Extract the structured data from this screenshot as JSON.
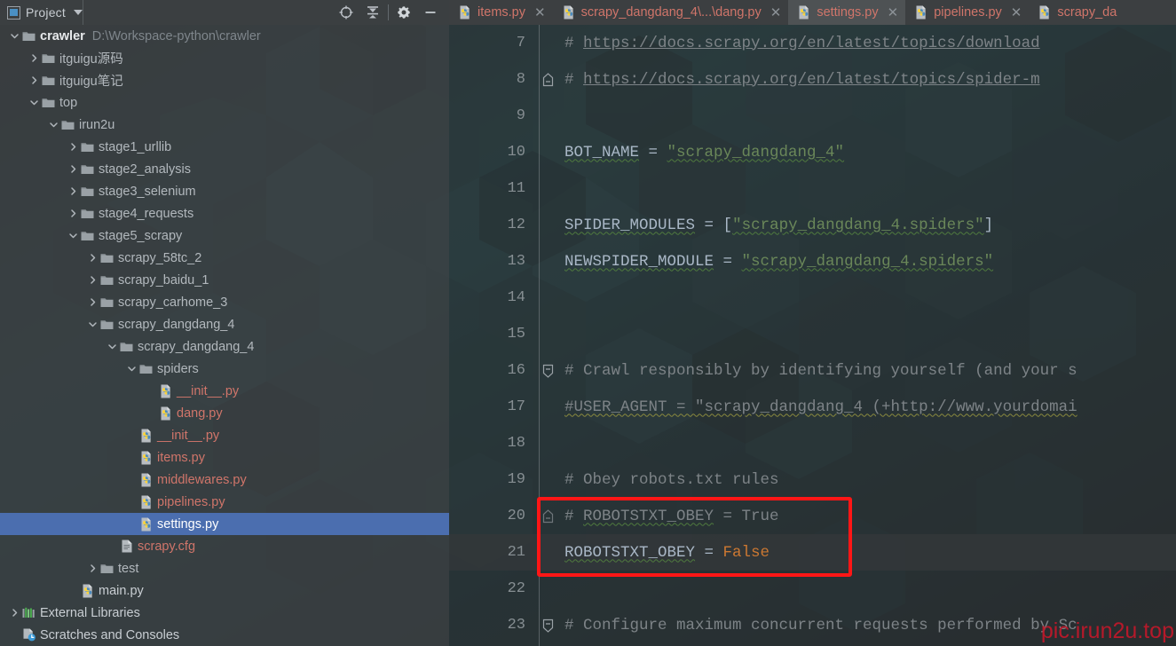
{
  "window": {
    "tool_window_title": "Project"
  },
  "project_toolbar": {
    "icons": [
      {
        "name": "locate-target-icon",
        "title": "Select Opened File"
      },
      {
        "name": "collapse-all-icon",
        "title": "Collapse All"
      },
      {
        "name": "gear-icon",
        "title": "Settings"
      },
      {
        "name": "minimize-icon",
        "title": "Hide"
      }
    ]
  },
  "project_tree": [
    {
      "label": "crawler",
      "path": "D:\\Workspace-python\\crawler",
      "depth": 0,
      "kind": "root",
      "state": "expanded",
      "icon": "folder-icon"
    },
    {
      "label": "itguigu源码",
      "depth": 1,
      "kind": "folder",
      "state": "collapsed",
      "icon": "folder-icon"
    },
    {
      "label": "itguigu笔记",
      "depth": 1,
      "kind": "folder",
      "state": "collapsed",
      "icon": "folder-icon"
    },
    {
      "label": "top",
      "depth": 1,
      "kind": "folder",
      "state": "expanded",
      "icon": "folder-icon"
    },
    {
      "label": "irun2u",
      "depth": 2,
      "kind": "folder",
      "state": "expanded",
      "icon": "folder-icon"
    },
    {
      "label": "stage1_urllib",
      "depth": 3,
      "kind": "folder",
      "state": "collapsed",
      "icon": "folder-icon"
    },
    {
      "label": "stage2_analysis",
      "depth": 3,
      "kind": "folder",
      "state": "collapsed",
      "icon": "folder-icon"
    },
    {
      "label": "stage3_selenium",
      "depth": 3,
      "kind": "folder",
      "state": "collapsed",
      "icon": "folder-icon"
    },
    {
      "label": "stage4_requests",
      "depth": 3,
      "kind": "folder",
      "state": "collapsed",
      "icon": "folder-icon"
    },
    {
      "label": "stage5_scrapy",
      "depth": 3,
      "kind": "folder",
      "state": "expanded",
      "icon": "folder-icon"
    },
    {
      "label": "scrapy_58tc_2",
      "depth": 4,
      "kind": "folder",
      "state": "collapsed",
      "icon": "folder-icon"
    },
    {
      "label": "scrapy_baidu_1",
      "depth": 4,
      "kind": "folder",
      "state": "collapsed",
      "icon": "folder-icon"
    },
    {
      "label": "scrapy_carhome_3",
      "depth": 4,
      "kind": "folder",
      "state": "collapsed",
      "icon": "folder-icon"
    },
    {
      "label": "scrapy_dangdang_4",
      "depth": 4,
      "kind": "folder",
      "state": "expanded",
      "icon": "folder-icon"
    },
    {
      "label": "scrapy_dangdang_4",
      "depth": 5,
      "kind": "folder",
      "state": "expanded",
      "icon": "folder-icon"
    },
    {
      "label": "spiders",
      "depth": 6,
      "kind": "folder",
      "state": "expanded",
      "icon": "folder-icon"
    },
    {
      "label": "__init__.py",
      "depth": 7,
      "kind": "python",
      "state": "leaf",
      "icon": "python-file-icon"
    },
    {
      "label": "dang.py",
      "depth": 7,
      "kind": "python",
      "state": "leaf",
      "icon": "python-file-icon"
    },
    {
      "label": "__init__.py",
      "depth": 6,
      "kind": "python",
      "state": "leaf",
      "icon": "python-file-icon"
    },
    {
      "label": "items.py",
      "depth": 6,
      "kind": "python",
      "state": "leaf",
      "icon": "python-file-icon"
    },
    {
      "label": "middlewares.py",
      "depth": 6,
      "kind": "python",
      "state": "leaf",
      "icon": "python-file-icon"
    },
    {
      "label": "pipelines.py",
      "depth": 6,
      "kind": "python",
      "state": "leaf",
      "icon": "python-file-icon"
    },
    {
      "label": "settings.py",
      "depth": 6,
      "kind": "python",
      "state": "leaf",
      "icon": "python-file-icon",
      "selected": true
    },
    {
      "label": "scrapy.cfg",
      "depth": 5,
      "kind": "cfg",
      "state": "leaf",
      "icon": "text-file-icon"
    },
    {
      "label": "test",
      "depth": 4,
      "kind": "folder",
      "state": "collapsed",
      "icon": "folder-icon"
    },
    {
      "label": "main.py",
      "depth": 3,
      "kind": "python-white",
      "state": "leaf",
      "icon": "python-file-icon"
    },
    {
      "label": "External Libraries",
      "depth": 0,
      "kind": "libs",
      "state": "collapsed",
      "icon": "libraries-icon"
    },
    {
      "label": "Scratches and Consoles",
      "depth": 0,
      "kind": "scratches",
      "state": "leaf",
      "icon": "scratches-icon"
    }
  ],
  "editor_tabs": [
    {
      "label": "items.py",
      "icon": "python-file-icon",
      "active": false,
      "closable": true
    },
    {
      "label": "scrapy_dangdang_4\\...\\dang.py",
      "icon": "python-file-icon",
      "active": false,
      "closable": true
    },
    {
      "label": "settings.py",
      "icon": "python-file-icon",
      "active": true,
      "closable": true
    },
    {
      "label": "pipelines.py",
      "icon": "python-file-icon",
      "active": false,
      "closable": true
    },
    {
      "label": "scrapy_da",
      "icon": "python-file-icon",
      "active": false,
      "closable": false
    }
  ],
  "code_lines": [
    {
      "num": "7",
      "fold": "none",
      "current": false,
      "tokens": [
        {
          "t": "#",
          "c": "c-cmt"
        },
        {
          "t": "      ",
          "c": "c-cmt"
        },
        {
          "t": "https://docs.scrapy.org/en/latest/topics/download",
          "c": "c-link"
        }
      ]
    },
    {
      "num": "8",
      "fold": "end",
      "current": false,
      "tokens": [
        {
          "t": "#",
          "c": "c-cmt"
        },
        {
          "t": "      ",
          "c": "c-cmt"
        },
        {
          "t": "https://docs.scrapy.org/en/latest/topics/spider-m",
          "c": "c-link"
        }
      ]
    },
    {
      "num": "9",
      "fold": "none",
      "current": false,
      "tokens": []
    },
    {
      "num": "10",
      "fold": "none",
      "current": false,
      "tokens": [
        {
          "t": "BOT_NAME",
          "c": "c-var sq-green"
        },
        {
          "t": " = ",
          "c": "c-op"
        },
        {
          "t": "\"scrapy_dangdang_4\"",
          "c": "c-str sq-green"
        }
      ]
    },
    {
      "num": "11",
      "fold": "none",
      "current": false,
      "tokens": []
    },
    {
      "num": "12",
      "fold": "none",
      "current": false,
      "tokens": [
        {
          "t": "SPIDER_MODULES",
          "c": "c-var sq-green"
        },
        {
          "t": " = ",
          "c": "c-op"
        },
        {
          "t": "[",
          "c": "c-brk"
        },
        {
          "t": "\"scrapy_dangdang_4.spiders\"",
          "c": "c-str sq-green"
        },
        {
          "t": "]",
          "c": "c-brk"
        }
      ]
    },
    {
      "num": "13",
      "fold": "none",
      "current": false,
      "tokens": [
        {
          "t": "NEWSPIDER_MODULE",
          "c": "c-var sq-green"
        },
        {
          "t": " = ",
          "c": "c-op"
        },
        {
          "t": "\"scrapy_dangdang_4.spiders\"",
          "c": "c-str sq-green"
        }
      ]
    },
    {
      "num": "14",
      "fold": "none",
      "current": false,
      "tokens": []
    },
    {
      "num": "15",
      "fold": "none",
      "current": false,
      "tokens": []
    },
    {
      "num": "16",
      "fold": "start",
      "current": false,
      "tokens": [
        {
          "t": "# Crawl responsibly by identifying yourself (and your s",
          "c": "c-cmt"
        }
      ]
    },
    {
      "num": "17",
      "fold": "none",
      "current": false,
      "tokens": [
        {
          "t": "#USER_AGENT = \"scrapy_dangdang_4 (+http://www.yourdomai",
          "c": "c-cmt sq-olive"
        }
      ]
    },
    {
      "num": "18",
      "fold": "none",
      "current": false,
      "tokens": []
    },
    {
      "num": "19",
      "fold": "none",
      "current": false,
      "tokens": [
        {
          "t": "# Obey robots.txt rules",
          "c": "c-cmt"
        }
      ]
    },
    {
      "num": "20",
      "fold": "boxed",
      "current": false,
      "tokens": [
        {
          "t": "# ",
          "c": "c-cmt"
        },
        {
          "t": "ROBOTSTXT_OBEY",
          "c": "c-cmt sq-green"
        },
        {
          "t": " = True",
          "c": "c-cmt"
        }
      ]
    },
    {
      "num": "21",
      "fold": "none",
      "current": true,
      "tokens": [
        {
          "t": "ROBOTSTXT_OBEY",
          "c": "c-var sq-green"
        },
        {
          "t": " = ",
          "c": "c-op"
        },
        {
          "t": "False",
          "c": "c-kw"
        }
      ]
    },
    {
      "num": "22",
      "fold": "none",
      "current": false,
      "tokens": []
    },
    {
      "num": "23",
      "fold": "start",
      "current": false,
      "tokens": [
        {
          "t": "# Configure maximum concurrent requests performed by Sc",
          "c": "c-cmt"
        }
      ]
    }
  ],
  "annotation": {
    "redbox_color": "#ff1616"
  },
  "watermark": {
    "text": "pic.irun2u.top",
    "color": "#c2182a"
  },
  "theme": {
    "selection_blue": "#4b6eaf",
    "python_file_red": "#d0756a",
    "string_green": "#6a8759",
    "keyword_orange": "#cc7832",
    "variable_gray": "#a9b7c6",
    "comment_gray": "#7d8387"
  }
}
